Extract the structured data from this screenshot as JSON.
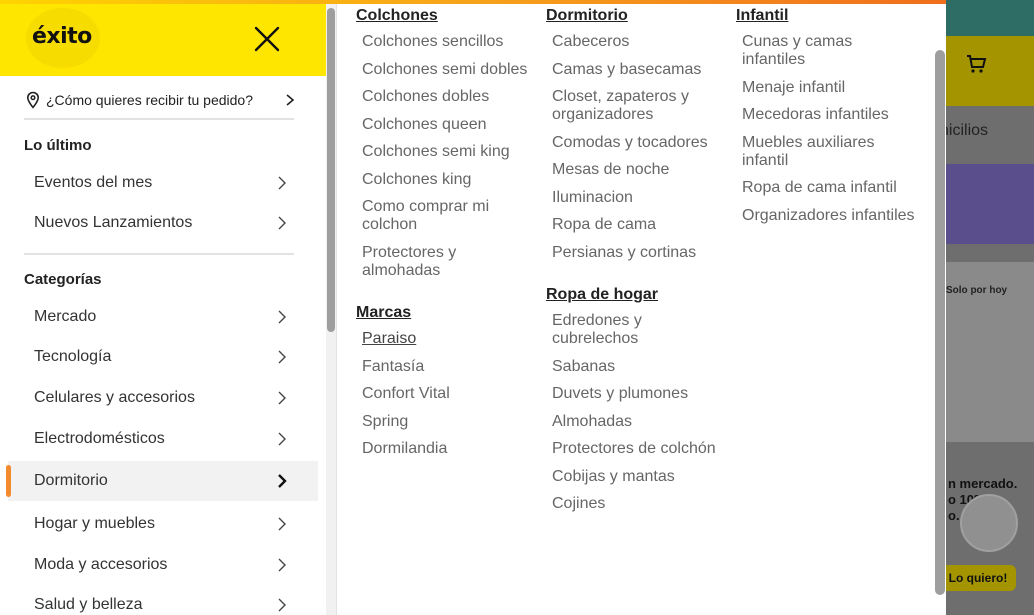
{
  "header": {
    "logo_text": "éxito",
    "delivery_prompt": "¿Cómo quieres recibir tu pedido?"
  },
  "sections": {
    "latest_title": "Lo último",
    "latest_items": [
      "Eventos del mes",
      "Nuevos Lanzamientos"
    ],
    "categories_title": "Categorías",
    "categories": [
      "Mercado",
      "Tecnología",
      "Celulares y accesorios",
      "Electrodomésticos",
      "Dormitorio",
      "Hogar y muebles",
      "Moda y accesorios",
      "Salud y belleza"
    ],
    "active_category": "Dormitorio"
  },
  "submenu": {
    "colchones": {
      "title": "Colchones",
      "items": [
        "Colchones sencillos",
        "Colchones semi dobles",
        "Colchones dobles",
        "Colchones queen",
        "Colchones semi king",
        "Colchones king",
        "Como comprar mi colchon",
        "Protectores y almohadas"
      ]
    },
    "marcas": {
      "title": "Marcas",
      "items": [
        "Paraiso",
        "Fantasía",
        "Confort Vital",
        "Spring",
        "Dormilandia"
      ]
    },
    "dormitorio": {
      "title": "Dormitorio",
      "items": [
        "Cabeceros",
        "Camas y basecamas",
        "Closet, zapateros y organizadores",
        "Comodas y tocadores",
        "Mesas de noche",
        "Iluminacion",
        "Ropa de cama",
        "Persianas y cortinas"
      ]
    },
    "ropa_hogar": {
      "title": "Ropa de hogar",
      "items": [
        "Edredones y cubrelechos",
        "Sabanas",
        "Duvets y plumones",
        "Almohadas",
        "Protectores de colchón",
        "Cobijas y mantas",
        "Cojines"
      ]
    },
    "infantil": {
      "title": "Infantil",
      "items": [
        "Cunas y camas infantiles",
        "Menaje infantil",
        "Mecedoras infantiles",
        "Muebles auxiliares infantil",
        "Ropa de cama infantil",
        "Organizadores infantiles"
      ]
    }
  },
  "background": {
    "domicilios_fragment": "nicilios",
    "promo_fragment": "Solo por hoy",
    "mercado_fragment_1": "n mercado.",
    "mercado_fragment_2": "o 10%",
    "mercado_fragment_3": "o.",
    "cta_fragment": "Lo quiero!"
  },
  "colors": {
    "brand_yellow": "#ffe600",
    "accent_orange": "#f28a2e",
    "text_dark": "#222222",
    "text_muted": "#666666"
  }
}
